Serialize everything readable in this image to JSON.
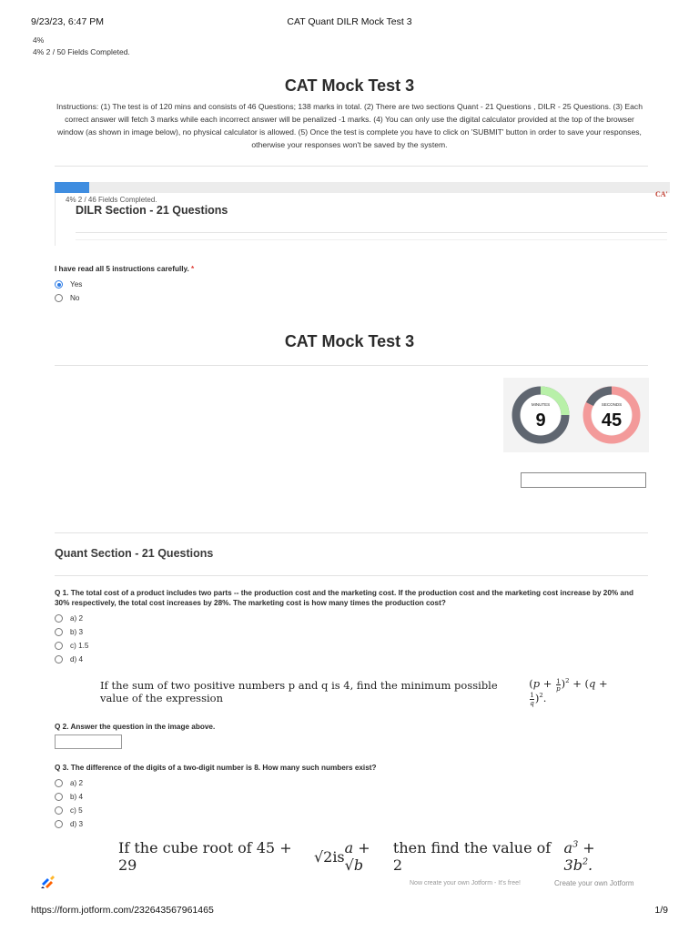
{
  "print": {
    "datetime": "9/23/23, 6:47 PM",
    "title": "CAT Quant DILR Mock Test 3",
    "url": "https://form.jotform.com/232643567961465",
    "page": "1/9"
  },
  "progress": {
    "percent_line": "4%",
    "fields_line": "4%   2 / 50 Fields Completed."
  },
  "form": {
    "title": "CAT Mock Test 3",
    "instructions": "Instructions: (1) The test is of 120 mins and consists of 46 Questions; 138 marks in total. (2) There are two sections Quant - 21 Questions , DILR - 25 Questions. (3) Each correct answer will fetch 3 marks while each incorrect answer will be penalized -1 marks. (4) You can only use the digital calculator provided at the top of the browser window (as shown in image below), no physical calculator is allowed. (5) Once the test is complete you have to click on 'SUBMIT' button in order to save your responses, otherwise your responses won't be saved by the system."
  },
  "embedded": {
    "progress_text": "4%   2 / 46 Fields Completed.",
    "progress_fraction": 0.04,
    "cat_text": "CA'",
    "section_title": "DILR Section - 21 Questions"
  },
  "confirm": {
    "label": "I have read all 5 instructions carefully.",
    "required_mark": "*",
    "options": [
      "Yes",
      "No"
    ],
    "selected": "Yes"
  },
  "second_title": "CAT Mock Test 3",
  "timer": {
    "minutes_label": "MINUTES",
    "minutes_value": "9",
    "seconds_label": "SECONDS",
    "seconds_value": "45",
    "colors": {
      "minutes_remaining": "#5f6670",
      "minutes_elapsed": "#b8f0a8",
      "seconds_remaining": "#f39a9a",
      "seconds_elapsed": "#5f6670"
    }
  },
  "quant_section": {
    "title": "Quant Section - 21 Questions"
  },
  "questions": [
    {
      "label": "Q 1. The total cost of a product includes two parts -- the production cost and the marketing cost. If the production cost and the marketing cost increase by 20% and 30% respectively, the total cost increases by 28%. The marketing cost is how many times the production cost?",
      "options": [
        "a) 2",
        "b) 3",
        "c) 1.5",
        "d) 4"
      ]
    },
    {
      "image_text": "If the sum of two positive numbers p and q is 4, find the minimum possible value of the expression",
      "label": "Q 2. Answer the question in the image above."
    },
    {
      "label": "Q 3. The difference of the digits of a two-digit number is 8. How many such numbers exist?",
      "options": [
        "a) 2",
        "b) 4",
        "c) 5",
        "d) 3"
      ]
    },
    {
      "image_text_pre": "If the cube root of 45 + 29",
      "image_text_mid": " is ",
      "image_text_post": " then find the value of 2"
    }
  ],
  "footer": {
    "note": "Now create your own Jotform - It's free!",
    "link": "Create your own Jotform"
  }
}
